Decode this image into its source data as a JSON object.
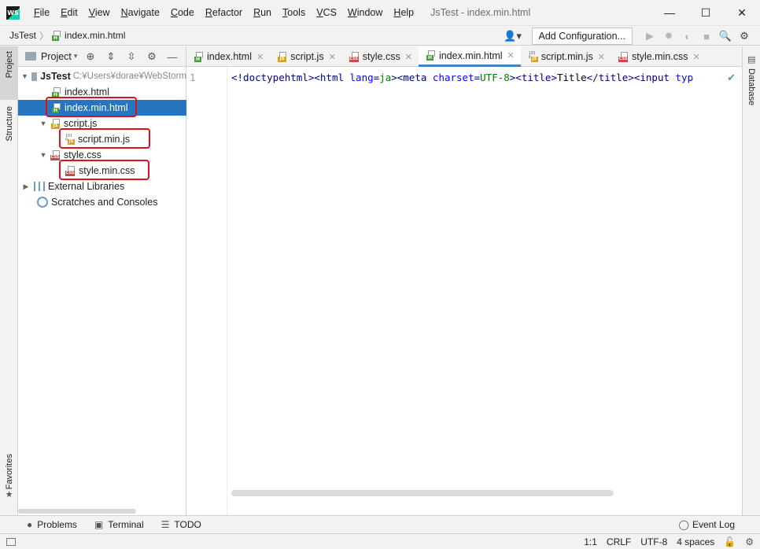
{
  "app": {
    "logo_text": "WS",
    "window_title": "JsTest - index.min.html",
    "menu": [
      "File",
      "Edit",
      "View",
      "Navigate",
      "Code",
      "Refactor",
      "Run",
      "Tools",
      "VCS",
      "Window",
      "Help"
    ],
    "controls": {
      "minimize": "—",
      "maximize": "☐",
      "close": "✕"
    }
  },
  "navbar": {
    "project": "JsTest",
    "file": "index.min.html",
    "add_config": "Add Configuration..."
  },
  "left_strip": {
    "project_tab": "Project",
    "structure_tab": "Structure",
    "favorites_tab": "Favorites"
  },
  "right_strip": {
    "database_tab": "Database"
  },
  "project_panel": {
    "title": "Project",
    "tree": {
      "root": "JsTest",
      "root_path": "C:¥Users¥dorae¥WebStorm",
      "items": [
        {
          "label": "index.html"
        },
        {
          "label": "index.min.html"
        },
        {
          "label": "script.js"
        },
        {
          "label": "script.min.js"
        },
        {
          "label": "style.css"
        },
        {
          "label": "style.min.css"
        }
      ],
      "external": "External Libraries",
      "scratches": "Scratches and Consoles"
    }
  },
  "editor": {
    "tabs": [
      {
        "label": "index.html",
        "icon": "html"
      },
      {
        "label": "script.js",
        "icon": "js"
      },
      {
        "label": "style.css",
        "icon": "css"
      },
      {
        "label": "index.min.html",
        "icon": "html",
        "active": true
      },
      {
        "label": "script.min.js",
        "icon": "bin"
      },
      {
        "label": "style.min.css",
        "icon": "css"
      }
    ],
    "line_number": "1",
    "code": {
      "t1": "<!doctype",
      "t2": "html",
      "t3": "><html ",
      "a1": "lang",
      "e1": "=",
      "v1": "ja",
      "t4": "><meta ",
      "a2": "charset",
      "e2": "=",
      "v2": "UTF-8",
      "t5": "><title>",
      "txt": "Title",
      "t6": "</title><input ",
      "a3": "typ"
    }
  },
  "bottom_tools": {
    "problems": "Problems",
    "terminal": "Terminal",
    "todo": "TODO",
    "event_log": "Event Log"
  },
  "status": {
    "position": "1:1",
    "line_sep": "CRLF",
    "encoding": "UTF-8",
    "indent": "4 spaces"
  },
  "colors": {
    "selection": "#2675bf",
    "highlight_box": "#e0101a",
    "active_tab_underline": "#4083c9"
  }
}
